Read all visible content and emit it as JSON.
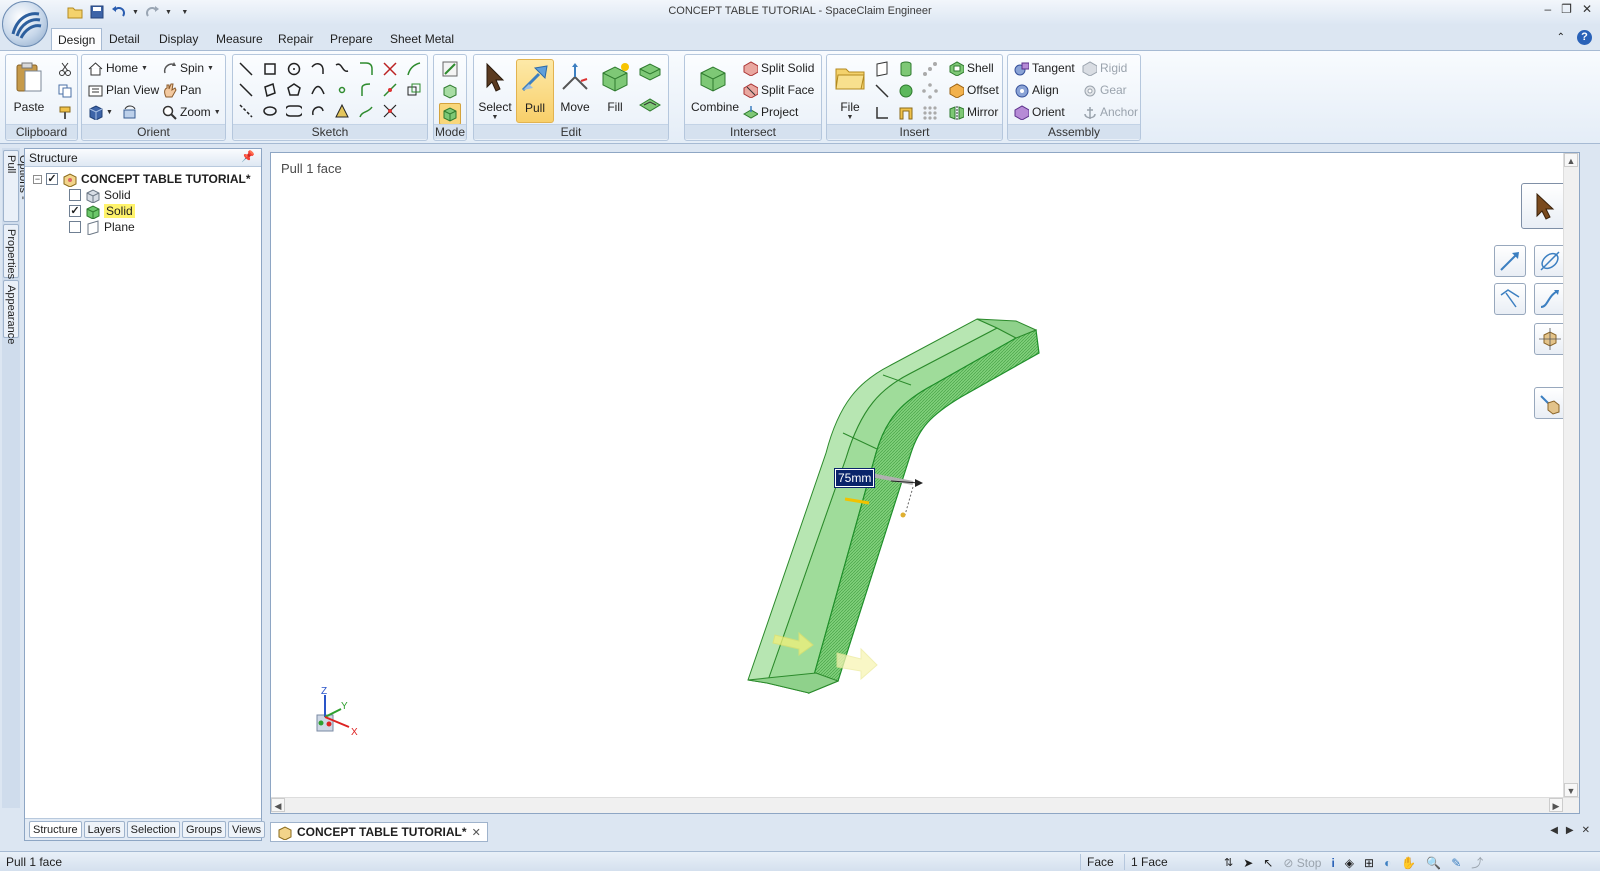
{
  "window": {
    "title": "CONCEPT TABLE TUTORIAL - SpaceClaim Engineer",
    "controls": [
      "–",
      "❐",
      "✕"
    ]
  },
  "quick_access": [
    "open-icon",
    "save-icon",
    "undo-icon",
    "redo-icon",
    "customize-icon"
  ],
  "ribbon_tabs": [
    "Design",
    "Detail",
    "Display",
    "Measure",
    "Repair",
    "Prepare",
    "Sheet Metal"
  ],
  "ribbon": {
    "clipboard": {
      "label": "Clipboard",
      "paste": "Paste"
    },
    "orient": {
      "label": "Orient",
      "home": "Home",
      "spin": "Spin",
      "plan_view": "Plan View",
      "pan": "Pan",
      "zoom": "Zoom"
    },
    "sketch": {
      "label": "Sketch"
    },
    "mode": {
      "label": "Mode"
    },
    "edit": {
      "label": "Edit",
      "select": "Select",
      "pull": "Pull",
      "move": "Move",
      "fill": "Fill"
    },
    "intersect": {
      "label": "Intersect",
      "combine": "Combine",
      "split_solid": "Split Solid",
      "split_face": "Split Face",
      "project": "Project"
    },
    "insert": {
      "label": "Insert",
      "file": "File",
      "shell": "Shell",
      "offset": "Offset",
      "mirror": "Mirror"
    },
    "assembly": {
      "label": "Assembly",
      "tangent": "Tangent",
      "align": "Align",
      "orient": "Orient",
      "rigid": "Rigid",
      "gear": "Gear",
      "anchor": "Anchor"
    }
  },
  "side_tabs": [
    "Options - Pull",
    "Properties",
    "Appearance"
  ],
  "structure": {
    "title": "Structure",
    "root": "CONCEPT TABLE TUTORIAL*",
    "items": [
      {
        "label": "Solid",
        "checked": false
      },
      {
        "label": "Solid",
        "checked": true
      },
      {
        "label": "Plane",
        "checked": false
      }
    ],
    "bottom_tabs": [
      "Structure",
      "Layers",
      "Selection",
      "Groups",
      "Views"
    ]
  },
  "viewport": {
    "hint": "Pull 1 face",
    "dimension": "75mm",
    "triad": {
      "z": "Z",
      "y": "Y",
      "x": "X"
    }
  },
  "document_tab": "CONCEPT TABLE TUTORIAL*",
  "statusbar": {
    "message": "Pull 1 face",
    "filter": "Face",
    "selection": "1 Face",
    "stop": "Stop"
  },
  "colors": {
    "accent": "#f8cf6a",
    "model_face": "#8fd18b",
    "model_edge": "#1f8f2a",
    "selection_highlight": "#fff36b"
  }
}
